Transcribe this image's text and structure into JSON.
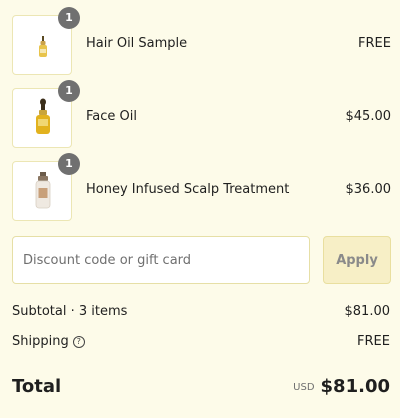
{
  "items": [
    {
      "name": "Hair Oil Sample",
      "price": "FREE",
      "quantity": "1"
    },
    {
      "name": "Face Oil",
      "price": "$45.00",
      "quantity": "1"
    },
    {
      "name": "Honey Infused Scalp Treatment",
      "price": "$36.00",
      "quantity": "1"
    }
  ],
  "discount": {
    "placeholder": "Discount code or gift card",
    "apply_label": "Apply"
  },
  "summary": {
    "subtotal_label": "Subtotal · 3 items",
    "subtotal_value": "$81.00",
    "shipping_label": "Shipping",
    "shipping_value": "FREE",
    "total_label": "Total",
    "currency": "USD",
    "total_value": "$81.00"
  },
  "icons": {
    "shipping_help": "question-circle-icon"
  },
  "colors": {
    "background": "#fdfbe9",
    "badge": "#707070",
    "apply_button": "#f7efc6",
    "thumbnail_border": "#ece6b4"
  }
}
